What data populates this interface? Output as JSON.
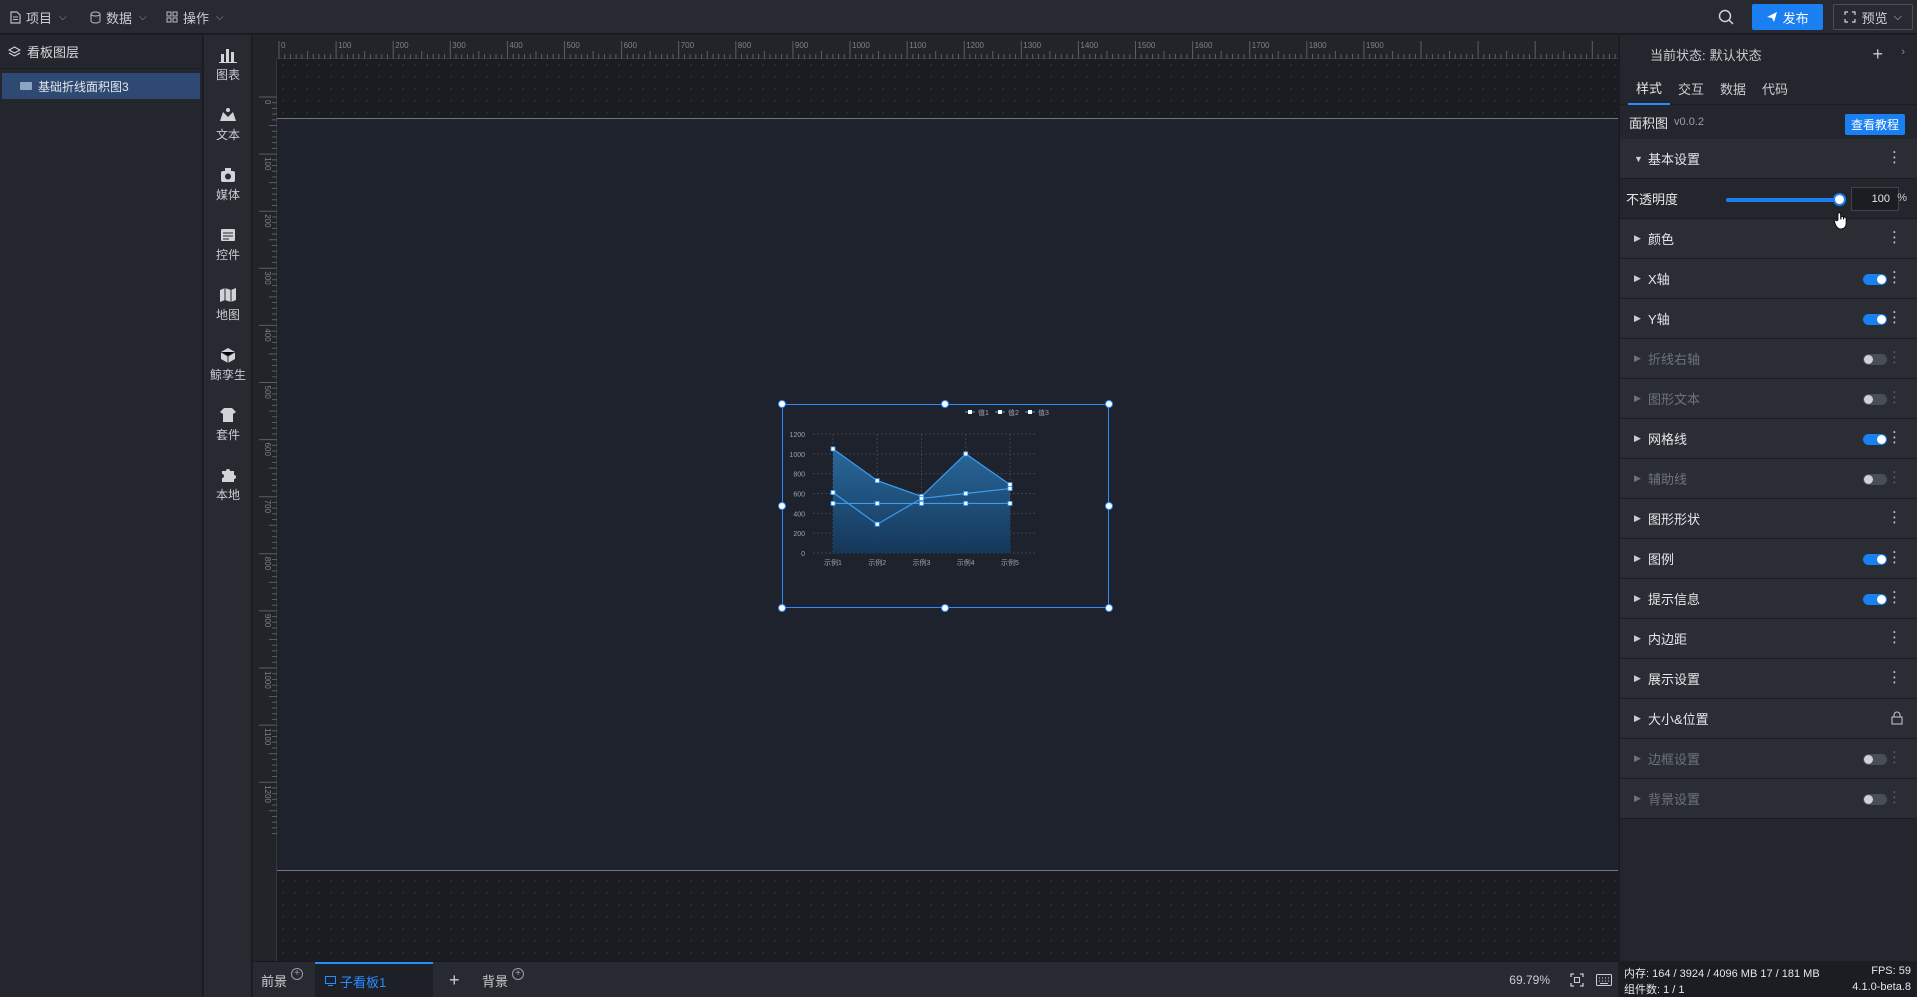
{
  "topbar": {
    "menus": [
      {
        "label": "项目",
        "icon": "file-icon"
      },
      {
        "label": "数据",
        "icon": "database-icon"
      },
      {
        "label": "操作",
        "icon": "grid-icon"
      }
    ],
    "publish_label": "发布",
    "preview_label": "预览"
  },
  "layers": {
    "title": "看板图层",
    "items": [
      {
        "label": "基础折线面积图3"
      }
    ]
  },
  "components": [
    {
      "label": "图表",
      "icon": "chart-icon"
    },
    {
      "label": "文本",
      "icon": "text-icon"
    },
    {
      "label": "媒体",
      "icon": "media-icon"
    },
    {
      "label": "控件",
      "icon": "control-icon"
    },
    {
      "label": "地图",
      "icon": "map-icon"
    },
    {
      "label": "鲸孪生",
      "icon": "twin-icon"
    },
    {
      "label": "套件",
      "icon": "kit-icon"
    },
    {
      "label": "本地",
      "icon": "plugin-icon"
    }
  ],
  "ruler": {
    "h_labels": [
      "0",
      "100",
      "200",
      "300",
      "400",
      "500",
      "600",
      "700",
      "800",
      "900",
      "1000",
      "1100",
      "1200",
      "1300",
      "1400",
      "1500",
      "1600",
      "1700",
      "1800",
      "1900"
    ],
    "v_labels": [
      "0",
      "100",
      "200",
      "300",
      "400",
      "500",
      "600",
      "700",
      "800",
      "900",
      "1000",
      "1100",
      "1200"
    ]
  },
  "chart_data": {
    "type": "line",
    "categories": [
      "示例1",
      "示例2",
      "示例3",
      "示例4",
      "示例5"
    ],
    "series": [
      {
        "name": "值1",
        "values": [
          1050,
          730,
          570,
          1000,
          690
        ],
        "area": true
      },
      {
        "name": "值2",
        "values": [
          610,
          290,
          550,
          600,
          650
        ],
        "area": false
      },
      {
        "name": "值3",
        "values": [
          500,
          500,
          500,
          500,
          500
        ],
        "area": false
      }
    ],
    "y_ticks": [
      "0",
      "200",
      "400",
      "600",
      "800",
      "1000",
      "1200"
    ],
    "ylim": [
      0,
      1200
    ],
    "grid": true,
    "legend": "top-right",
    "colors": {
      "line": "#3a9cf2",
      "area_top": "#2a6fa8",
      "area_bottom": "#143a5e"
    }
  },
  "bottom": {
    "tabs": [
      {
        "label": "前景"
      },
      {
        "label": "子看板1"
      },
      {
        "label": "背景"
      }
    ],
    "zoom": "69.79%"
  },
  "right": {
    "state_label": "当前状态:",
    "state_value": "默认状态",
    "tabs": [
      "样式",
      "交互",
      "数据",
      "代码"
    ],
    "widget_name": "面积图",
    "widget_version": "v0.0.2",
    "tutorial_label": "查看教程",
    "basic_label": "基本设置",
    "opacity_label": "不透明度",
    "opacity_value": "100",
    "opacity_unit": "%",
    "opacity_level": 1.0,
    "sections": [
      {
        "label": "颜色",
        "toggle": null,
        "disabled": false
      },
      {
        "label": "X轴",
        "toggle": true,
        "disabled": false
      },
      {
        "label": "Y轴",
        "toggle": true,
        "disabled": false
      },
      {
        "label": "折线右轴",
        "toggle": false,
        "disabled": true
      },
      {
        "label": "图形文本",
        "toggle": false,
        "disabled": true
      },
      {
        "label": "网格线",
        "toggle": true,
        "disabled": false
      },
      {
        "label": "辅助线",
        "toggle": false,
        "disabled": true
      },
      {
        "label": "图形形状",
        "toggle": null,
        "disabled": false
      },
      {
        "label": "图例",
        "toggle": true,
        "disabled": false
      },
      {
        "label": "提示信息",
        "toggle": true,
        "disabled": false
      },
      {
        "label": "内边距",
        "toggle": null,
        "disabled": false
      },
      {
        "label": "展示设置",
        "toggle": null,
        "disabled": false
      },
      {
        "label": "大小&位置",
        "toggle": "lock",
        "disabled": false
      },
      {
        "label": "边框设置",
        "toggle": false,
        "disabled": true
      },
      {
        "label": "背景设置",
        "toggle": false,
        "disabled": true
      }
    ]
  },
  "status": {
    "memory": "内存: 164 / 3924 / 4096 MB 17 / 181 MB",
    "fps": "FPS: 59",
    "count": "组件数: 1 / 1",
    "version": "4.1.0-beta.8"
  }
}
